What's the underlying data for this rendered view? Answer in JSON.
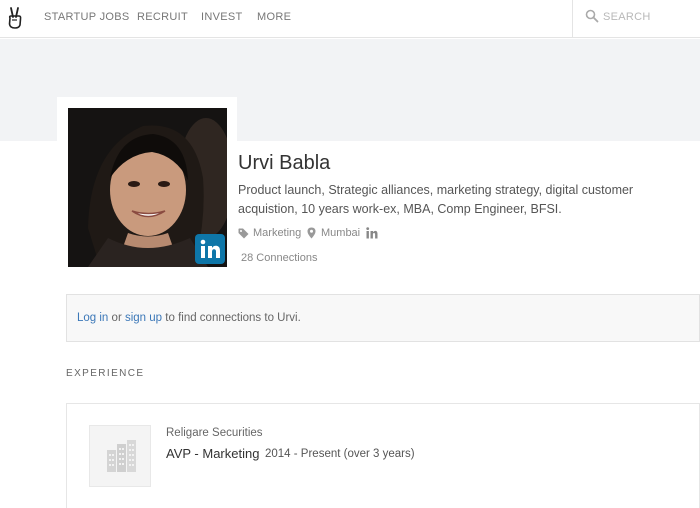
{
  "nav": {
    "links": [
      "STARTUP JOBS",
      "RECRUIT",
      "INVEST",
      "MORE"
    ],
    "search_placeholder": "SEARCH"
  },
  "profile": {
    "name": "Urvi Babla",
    "bio": "Product launch, Strategic alliances, marketing strategy, digital customer acquistion, 10 years work-ex, MBA, Comp Engineer, BFSI.",
    "role_tag": "Marketing",
    "location": "Mumbai",
    "connections": "28 Connections"
  },
  "notice": {
    "login": "Log in",
    "or": "or",
    "signup": "sign up",
    "rest": "to find connections to Urvi."
  },
  "experience": {
    "title": "EXPERIENCE",
    "items": [
      {
        "company": "Religare Securities",
        "role": "AVP - Marketing",
        "dates": "2014 - Present (over 3 years)"
      }
    ]
  },
  "colors": {
    "link": "#3c78b8",
    "linkedin": "#0e76a8",
    "banner": "#f2f3f5"
  },
  "icons": [
    "peace-hand-logo",
    "search-icon",
    "tag-icon",
    "location-pin-icon",
    "linkedin-icon",
    "building-icon"
  ]
}
